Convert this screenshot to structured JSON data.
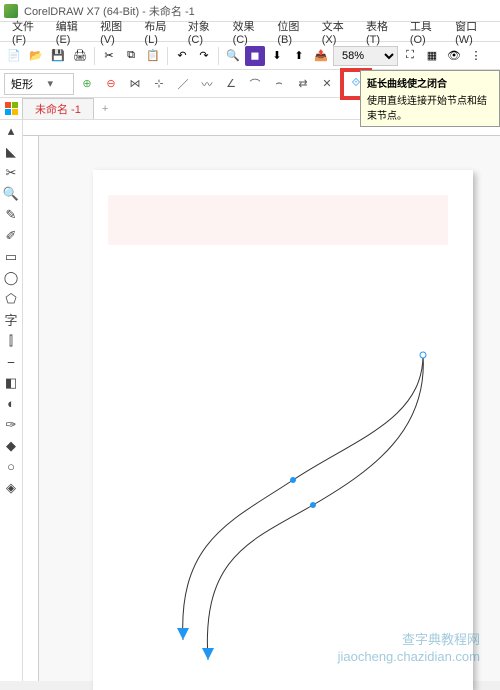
{
  "app": {
    "title": "CorelDRAW X7 (64-Bit) - 未命名 -1"
  },
  "menu": {
    "file": "文件(F)",
    "edit": "编辑(E)",
    "view": "视图(V)",
    "layout": "布局(L)",
    "object": "对象(C)",
    "effects": "效果(C)",
    "bitmaps": "位图(B)",
    "text": "文本(X)",
    "table": "表格(T)",
    "tools": "工具(O)",
    "window": "窗口(W)"
  },
  "toolbar": {
    "zoom": "58%"
  },
  "propbar": {
    "shape": "矩形"
  },
  "tab": {
    "name": "未命名 -1",
    "add": "+"
  },
  "tooltip": {
    "title": "延长曲线使之闭合",
    "body": "使用直线连接开始节点和结束节点。"
  },
  "watermark": {
    "line1": "查字典教程网",
    "line2": "jiaocheng.chazidian.com"
  }
}
